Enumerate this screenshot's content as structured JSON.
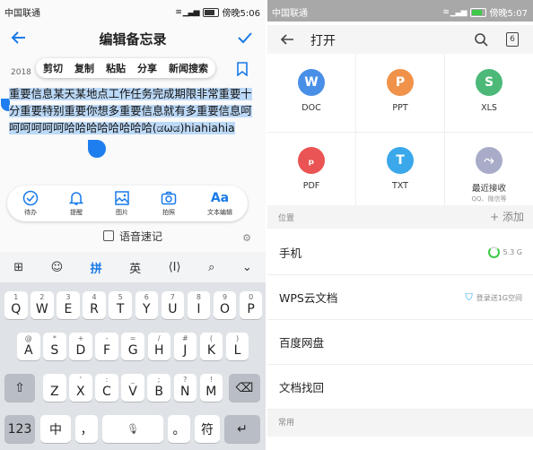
{
  "left": {
    "status": {
      "carrier": "中国联通",
      "time": "傍晚5:06"
    },
    "header": {
      "title": "编辑备忘录"
    },
    "context_menu": [
      "剪切",
      "复制",
      "粘贴",
      "分享",
      "新闻搜索"
    ],
    "date_fragment": "2018",
    "note_text": "重要信息某天某地点工作任务完成期限非常重要十分重要特别重要你想多重要信息就有多重要信息呵呵呵呵呵呵哈哈哈哈哈哈哈哈(ಡωಡ)hiahiahia",
    "tools": [
      {
        "label": "待办",
        "icon": "check-circle-icon"
      },
      {
        "label": "提醒",
        "icon": "bell-icon"
      },
      {
        "label": "图片",
        "icon": "image-icon"
      },
      {
        "label": "拍照",
        "icon": "camera-icon"
      },
      {
        "label": "文本编辑",
        "icon": "text-format-icon"
      }
    ],
    "voice_label": "语音速记",
    "keyboard_toolbar": [
      "⊞",
      "☺",
      "拼",
      "英",
      "⟨I⟩",
      "⌕",
      "⌄"
    ],
    "keyboard": {
      "row1": [
        [
          "1",
          "Q"
        ],
        [
          "2",
          "W"
        ],
        [
          "3",
          "E"
        ],
        [
          "4",
          "R"
        ],
        [
          "5",
          "T"
        ],
        [
          "6",
          "Y"
        ],
        [
          "7",
          "U"
        ],
        [
          "8",
          "I"
        ],
        [
          "9",
          "O"
        ],
        [
          "0",
          "P"
        ]
      ],
      "row2": [
        [
          "@",
          "A"
        ],
        [
          "*",
          "S"
        ],
        [
          "+",
          "D"
        ],
        [
          "-",
          "F"
        ],
        [
          "=",
          "G"
        ],
        [
          "/",
          "H"
        ],
        [
          "#",
          "J"
        ],
        [
          "(",
          "K"
        ],
        [
          ")",
          "L"
        ]
      ],
      "row3": [
        [
          "",
          "Z"
        ],
        [
          "'",
          "X"
        ],
        [
          ":",
          "C"
        ],
        [
          "_",
          "V"
        ],
        [
          ";",
          "B"
        ],
        [
          "?",
          "N"
        ],
        [
          "!",
          "M"
        ]
      ],
      "bottom": {
        "num": "123",
        "lang": "中",
        "comma": "，",
        "period": "。",
        "symbol": "符"
      }
    }
  },
  "right": {
    "status": {
      "carrier": "中国联通",
      "time": "傍晚5:07"
    },
    "header": {
      "title": "打开",
      "tab_count": "6"
    },
    "file_types": [
      {
        "label": "DOC",
        "sub": "",
        "color": "#4a8fe7",
        "glyph": "W"
      },
      {
        "label": "PPT",
        "sub": "",
        "color": "#f0924a",
        "glyph": "P"
      },
      {
        "label": "XLS",
        "sub": "",
        "color": "#4cb979",
        "glyph": "S"
      },
      {
        "label": "PDF",
        "sub": "",
        "color": "#ea5454",
        "glyph": "ₚ"
      },
      {
        "label": "TXT",
        "sub": "",
        "color": "#3aa8ea",
        "glyph": "T"
      },
      {
        "label": "最近接收",
        "sub": "QQ、微信等",
        "color": "#a8acc8",
        "glyph": "⤳"
      }
    ],
    "location_title": "位置",
    "add_label": "+ 添加",
    "locations": [
      {
        "label": "手机",
        "right": "5.3 G"
      },
      {
        "label": "WPS云文档",
        "right": "登录送1G空间"
      },
      {
        "label": "百度网盘",
        "right": ""
      },
      {
        "label": "文档找回",
        "right": ""
      }
    ],
    "common_title": "常用"
  }
}
